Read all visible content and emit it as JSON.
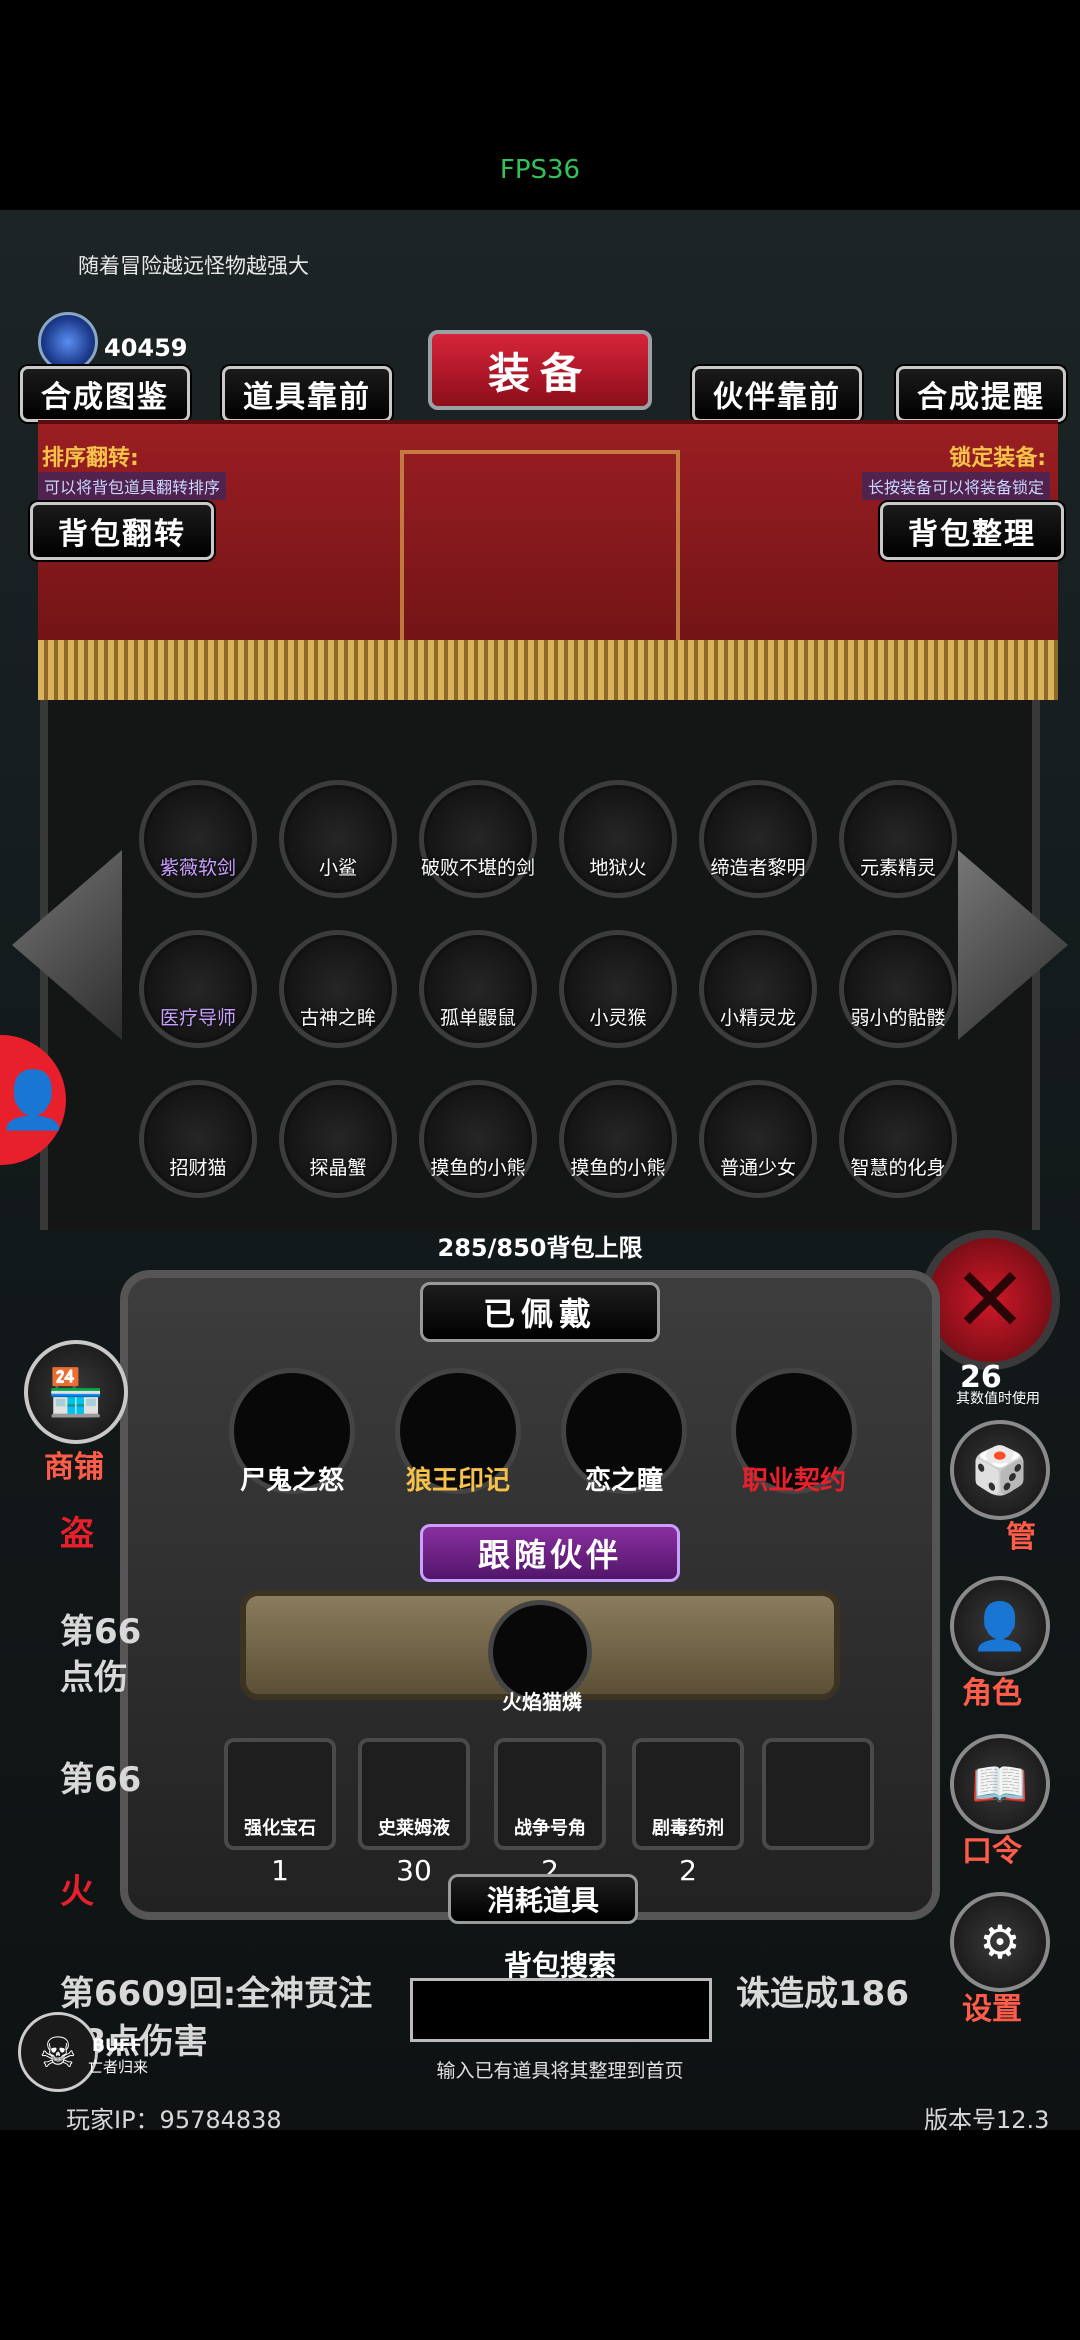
{
  "fps": "FPS36",
  "hint": "随着冒险越远怪物越强大",
  "currency": "40459",
  "colors": {
    "accent_red": "#c81a2c",
    "gold": "#f6c24a",
    "gem_blue": "#3a6fd8"
  },
  "title": "装备",
  "top_buttons": [
    "合成图鉴",
    "道具靠前",
    "伙伴靠前",
    "合成提醒"
  ],
  "left_note": {
    "title": "排序翻转:",
    "desc": "可以将背包道具翻转排序",
    "button": "背包翻转"
  },
  "right_note": {
    "title": "锁定装备:",
    "desc": "长按装备可以将装备锁定",
    "button": "背包整理"
  },
  "inventory": [
    {
      "label": "紫薇软剑",
      "icon": "sword-icon",
      "color": "#c8a0ff"
    },
    {
      "label": "小鲨",
      "icon": "shark-icon",
      "color": "#ffffff"
    },
    {
      "label": "破败不堪的剑",
      "icon": "broken-sword-icon",
      "color": "#ffffff"
    },
    {
      "label": "地狱火",
      "icon": "fireball-icon",
      "color": "#ffffff"
    },
    {
      "label": "缔造者黎明",
      "icon": "greatsword-icon",
      "color": "#ffffff"
    },
    {
      "label": "元素精灵",
      "icon": "scorpion-icon",
      "color": "#ffffff"
    },
    {
      "label": "医疗导师",
      "icon": "healer-icon",
      "color": "#c8a0ff"
    },
    {
      "label": "古神之眸",
      "icon": "eye-icon",
      "color": "#ffffff"
    },
    {
      "label": "孤单鼹鼠",
      "icon": "mole-icon",
      "color": "#ffffff"
    },
    {
      "label": "小灵猴",
      "icon": "monkey-icon",
      "color": "#ffffff"
    },
    {
      "label": "小精灵龙",
      "icon": "dragon-icon",
      "color": "#ffffff"
    },
    {
      "label": "弱小的骷髅",
      "icon": "skeleton-icon",
      "color": "#ffffff"
    },
    {
      "label": "招财猫",
      "icon": "lucky-cat-icon",
      "color": "#ffffff"
    },
    {
      "label": "探晶蟹",
      "icon": "crab-icon",
      "color": "#ffffff"
    },
    {
      "label": "摸鱼的小熊",
      "icon": "bear-icon",
      "color": "#ffffff"
    },
    {
      "label": "摸鱼的小熊",
      "icon": "bear-icon",
      "color": "#ffffff"
    },
    {
      "label": "普通少女",
      "icon": "witch-icon",
      "color": "#ffffff"
    },
    {
      "label": "智慧的化身",
      "icon": "spirit-icon",
      "color": "#ffffff"
    }
  ],
  "capacity": "285/850背包上限",
  "worn_title": "已佩戴",
  "equipped": [
    {
      "label": "尸鬼之怒",
      "icon": "claw-icon",
      "color": "#ffffff"
    },
    {
      "label": "狼王印记",
      "icon": "wolf-mark-icon",
      "color": "#f6c24a"
    },
    {
      "label": "恋之瞳",
      "icon": "necklace-icon",
      "color": "#ffffff"
    },
    {
      "label": "职业契约",
      "icon": "contract-icon",
      "color": "#e8202c"
    }
  ],
  "follow_title": "跟随伙伴",
  "pet": {
    "label": "火焰猫燐",
    "icon": "cat-girl-icon"
  },
  "consumables": [
    {
      "label": "强化宝石",
      "count": "1",
      "icon": "gem-icon"
    },
    {
      "label": "史莱姆液",
      "count": "30",
      "icon": "potion-icon"
    },
    {
      "label": "战争号角",
      "count": "2",
      "icon": "horn-icon"
    },
    {
      "label": "剧毒药剂",
      "count": "2",
      "icon": "poison-icon"
    },
    {
      "label": "",
      "count": "",
      "icon": ""
    }
  ],
  "consumables_title": "消耗道具",
  "search": {
    "title": "背包搜索",
    "placeholder": "",
    "hint": "输入已有道具将其整理到首页"
  },
  "side_menu": {
    "shop": "商铺",
    "top_right_small": "其数值时使用",
    "top_right_value": "26",
    "manage": "管",
    "role": "角色",
    "code": "口令",
    "settings": "设置"
  },
  "log": {
    "line1": "盗",
    "line2a": "第66",
    "line2b": "点伤",
    "line3": "第66",
    "line4": "火",
    "line5": "第6609回:全神贯注",
    "line5b": "诛造成186",
    "line6": "8点伤害"
  },
  "buff": {
    "label": "BUFF",
    "sub": "亡者归来"
  },
  "footer": {
    "player_ip": "玩家IP：95784838",
    "version": "版本号12.3"
  }
}
